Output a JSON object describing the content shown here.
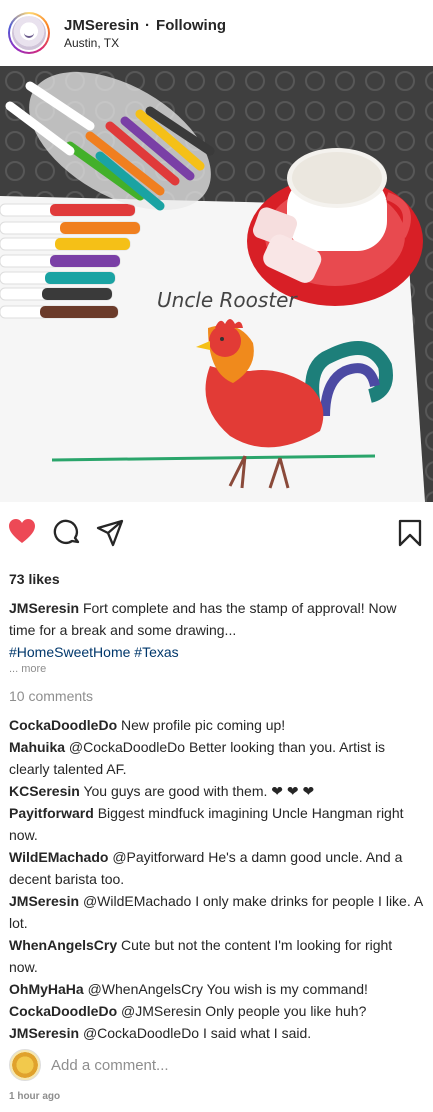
{
  "header": {
    "username": "JMSeresin",
    "separator": "·",
    "follow_state": "Following",
    "location": "Austin, TX"
  },
  "photo": {
    "drawing_label": "Uncle Rooster"
  },
  "actions": {
    "like_icon": "heart-icon",
    "comment_icon": "comment-icon",
    "share_icon": "share-icon",
    "save_icon": "bookmark-icon",
    "liked": true,
    "like_color": "#ed4956"
  },
  "likes_text": "73 likes",
  "caption": {
    "username": "JMSeresin",
    "text": "Fort complete and has the stamp of approval! Now time for a break and some drawing...",
    "hashtag1": "#HomeSweetHome",
    "hashtag2": "#Texas",
    "more": "... more"
  },
  "comment_count": "10 comments",
  "comments": [
    {
      "user": "CockaDoodleDo",
      "text": "New profile pic coming up!"
    },
    {
      "user": "Mahuika",
      "text": "@CockaDoodleDo Better looking than you. Artist is clearly talented AF."
    },
    {
      "user": "KCSeresin",
      "text": "You guys are good with them. ❤ ❤ ❤"
    },
    {
      "user": "Payitforward",
      "text": "Biggest mindfuck imagining Uncle Hangman right now."
    },
    {
      "user": "WildEMachado",
      "text": "@Payitforward He's a damn good uncle. And a decent barista too."
    },
    {
      "user": "JMSeresin",
      "text": "@WildEMachado I only make drinks for people I like. A lot."
    },
    {
      "user": "WhenAngelsCry",
      "text": "Cute but not the content I'm looking for right now."
    },
    {
      "user": "OhMyHaHa",
      "text": "@WhenAngelsCry You wish is my command!"
    },
    {
      "user": "CockaDoodleDo",
      "text": "@JMSeresin Only people you like huh?"
    },
    {
      "user": "JMSeresin",
      "text": "@CockaDoodleDo I said what I said."
    }
  ],
  "add_comment": {
    "placeholder": "Add a comment..."
  },
  "timestamp": "1 hour ago"
}
